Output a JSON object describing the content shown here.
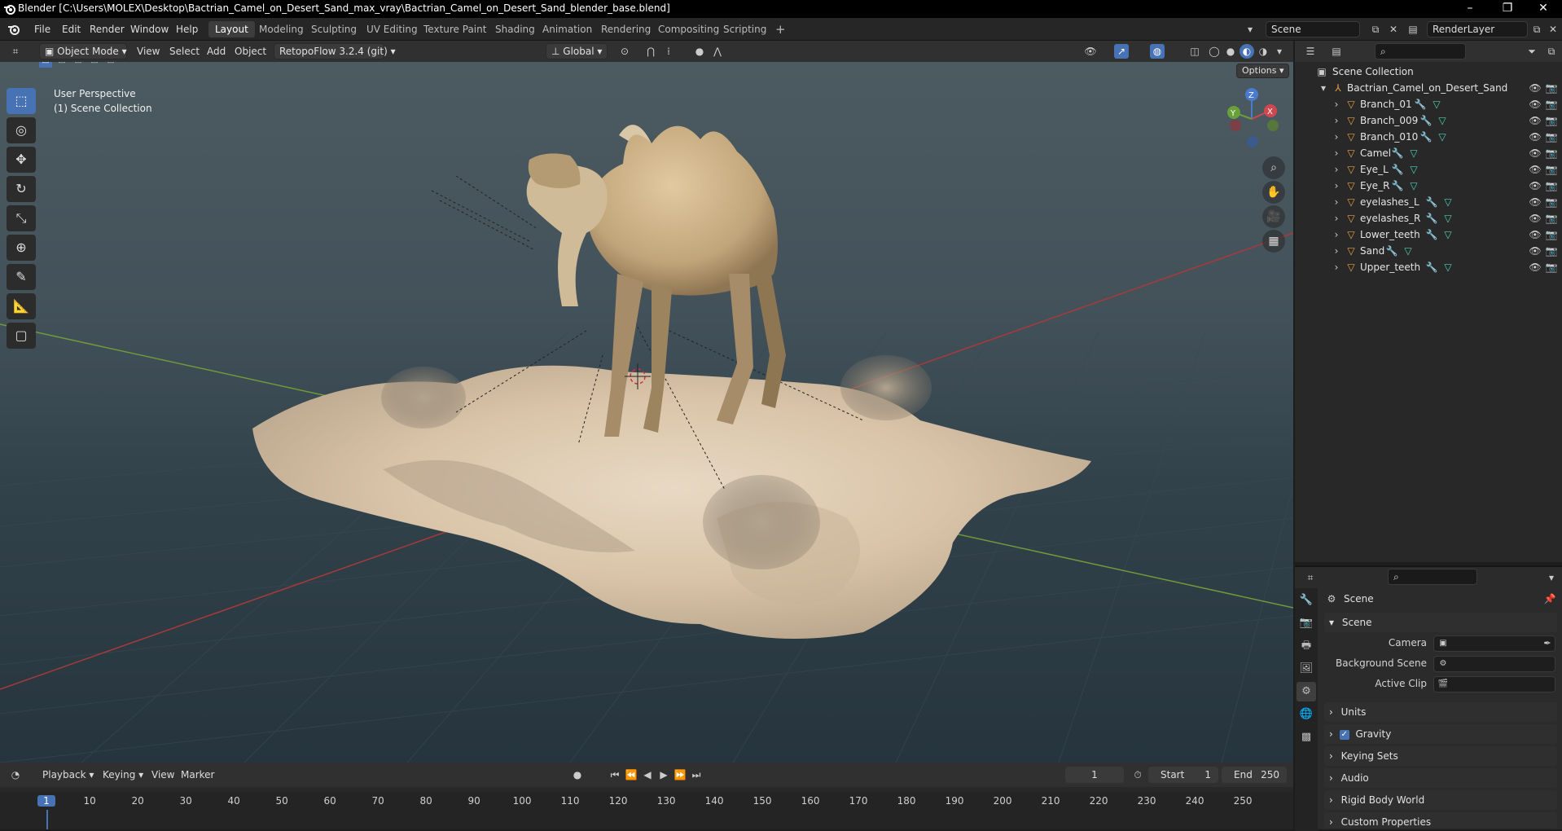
{
  "window": {
    "title": "Blender [C:\\Users\\MOLEX\\Desktop\\Bactrian_Camel_on_Desert_Sand_max_vray\\Bactrian_Camel_on_Desert_Sand_blender_base.blend]",
    "minimize": "–",
    "maximize": "❐",
    "close": "✕"
  },
  "menu": {
    "items": [
      "File",
      "Edit",
      "Render",
      "Window",
      "Help"
    ],
    "workspaces": [
      "Layout",
      "Modeling",
      "Sculpting",
      "UV Editing",
      "Texture Paint",
      "Shading",
      "Animation",
      "Rendering",
      "Compositing",
      "Scripting"
    ],
    "active_workspace": "Layout",
    "add_workspace": "+",
    "scene": "Scene",
    "view_layer": "RenderLayer"
  },
  "viewport_header": {
    "mode": "Object Mode",
    "menus": [
      "View",
      "Select",
      "Add",
      "Object"
    ],
    "addon": "RetopoFlow 3.2.4 (git)",
    "orientation": "Global",
    "options": "Options"
  },
  "viewport": {
    "perspective": "User Perspective",
    "collection": "(1) Scene Collection",
    "gizmo": {
      "x": "X",
      "y": "Y",
      "z": "Z"
    },
    "background_colors": {
      "top": "#4c5a61",
      "bottom": "#26353d",
      "x_axis": "#a83a3a",
      "y_axis": "#6f9a3a"
    }
  },
  "outliner": {
    "root": "Scene Collection",
    "collection": "Bactrian_Camel_on_Desert_Sand",
    "objects": [
      {
        "name": "Branch_01"
      },
      {
        "name": "Branch_009"
      },
      {
        "name": "Branch_010"
      },
      {
        "name": "Camel"
      },
      {
        "name": "Eye_L"
      },
      {
        "name": "Eye_R"
      },
      {
        "name": "eyelashes_L"
      },
      {
        "name": "eyelashes_R"
      },
      {
        "name": "Lower_teeth"
      },
      {
        "name": "Sand"
      },
      {
        "name": "Upper_teeth"
      }
    ]
  },
  "properties": {
    "context": "Scene",
    "panel": "Scene",
    "camera_label": "Camera",
    "background_scene_label": "Background Scene",
    "active_clip_label": "Active Clip",
    "subpanels": [
      "Units",
      "Gravity",
      "Keying Sets",
      "Audio",
      "Rigid Body World",
      "Custom Properties"
    ],
    "gravity_checked": true
  },
  "timeline": {
    "menus": [
      "Playback",
      "Keying",
      "View",
      "Marker"
    ],
    "current_frame": "1",
    "start_label": "Start",
    "start": "1",
    "end_label": "End",
    "end": "250",
    "ticks": [
      "1",
      "10",
      "20",
      "30",
      "40",
      "50",
      "60",
      "70",
      "80",
      "90",
      "100",
      "110",
      "120",
      "130",
      "140",
      "150",
      "160",
      "170",
      "180",
      "190",
      "200",
      "210",
      "220",
      "230",
      "240",
      "250"
    ]
  }
}
